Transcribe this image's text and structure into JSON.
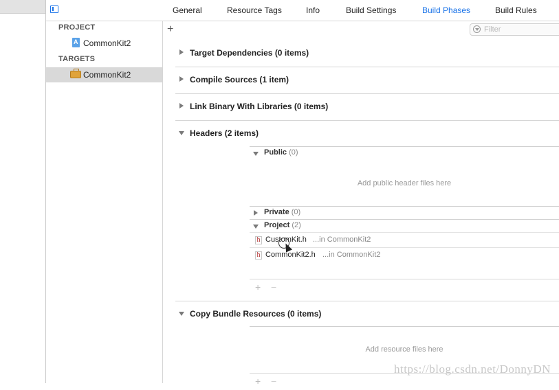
{
  "tabs": [
    "General",
    "Resource Tags",
    "Info",
    "Build Settings",
    "Build Phases",
    "Build Rules"
  ],
  "active_tab": "Build Phases",
  "navigator": {
    "project_header": "PROJECT",
    "project_item": "CommonKit2",
    "targets_header": "TARGETS",
    "target_item": "CommonKit2"
  },
  "toolbar": {
    "add_label": "+",
    "filter_placeholder": "Filter"
  },
  "phases": {
    "target_dependencies": "Target Dependencies (0 items)",
    "compile_sources": "Compile Sources (1 item)",
    "link_binary": "Link Binary With Libraries (0 items)",
    "headers": "Headers (2 items)",
    "copy_bundle": "Copy Bundle Resources (0 items)"
  },
  "headers_groups": {
    "public_label": "Public",
    "public_count": "(0)",
    "public_placeholder": "Add public header files here",
    "private_label": "Private",
    "private_count": "(0)",
    "project_label": "Project",
    "project_count": "(2)",
    "files": [
      {
        "name": "CustomKit.h",
        "location": "...in CommonKit2"
      },
      {
        "name": "CommonKit2.h",
        "location": "...in CommonKit2"
      }
    ]
  },
  "copy_bundle_placeholder": "Add resource files here",
  "controls": {
    "plus": "+",
    "minus": "−",
    "file_icon": "h"
  },
  "watermark": "https://blog.csdn.net/DonnyDN",
  "colors": {
    "accent": "#1a73e8",
    "selected_row": "#d9d9d9"
  }
}
